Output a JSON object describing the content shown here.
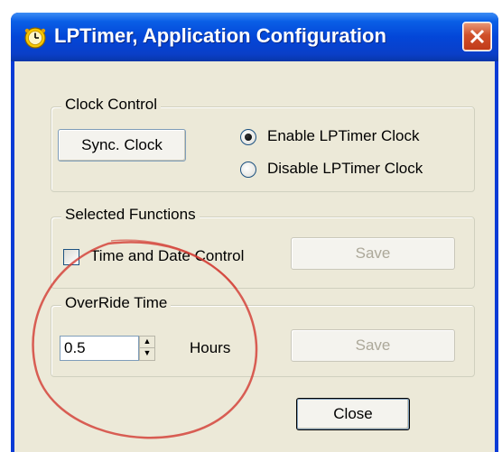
{
  "window": {
    "title": "LPTimer, Application Configuration",
    "icon": "clock-icon",
    "close_glyph": "close-icon",
    "colors": {
      "titlebar": "#0346d8",
      "client": "#ece9d8",
      "close": "#d0502a",
      "annotation": "#d33a32"
    }
  },
  "clock_control": {
    "legend": "Clock Control",
    "sync_button": "Sync. Clock",
    "enable_label": "Enable LPTimer Clock",
    "disable_label": "Disable LPTimer Clock",
    "selected": "enable"
  },
  "selected_functions": {
    "legend": "Selected Functions",
    "checkbox_label": "Time and Date Control",
    "checked": false,
    "save_button": "Save"
  },
  "override_time": {
    "legend": "OverRide Time",
    "value": "0.5",
    "unit": "Hours",
    "save_button": "Save"
  },
  "footer": {
    "close_button": "Close"
  }
}
